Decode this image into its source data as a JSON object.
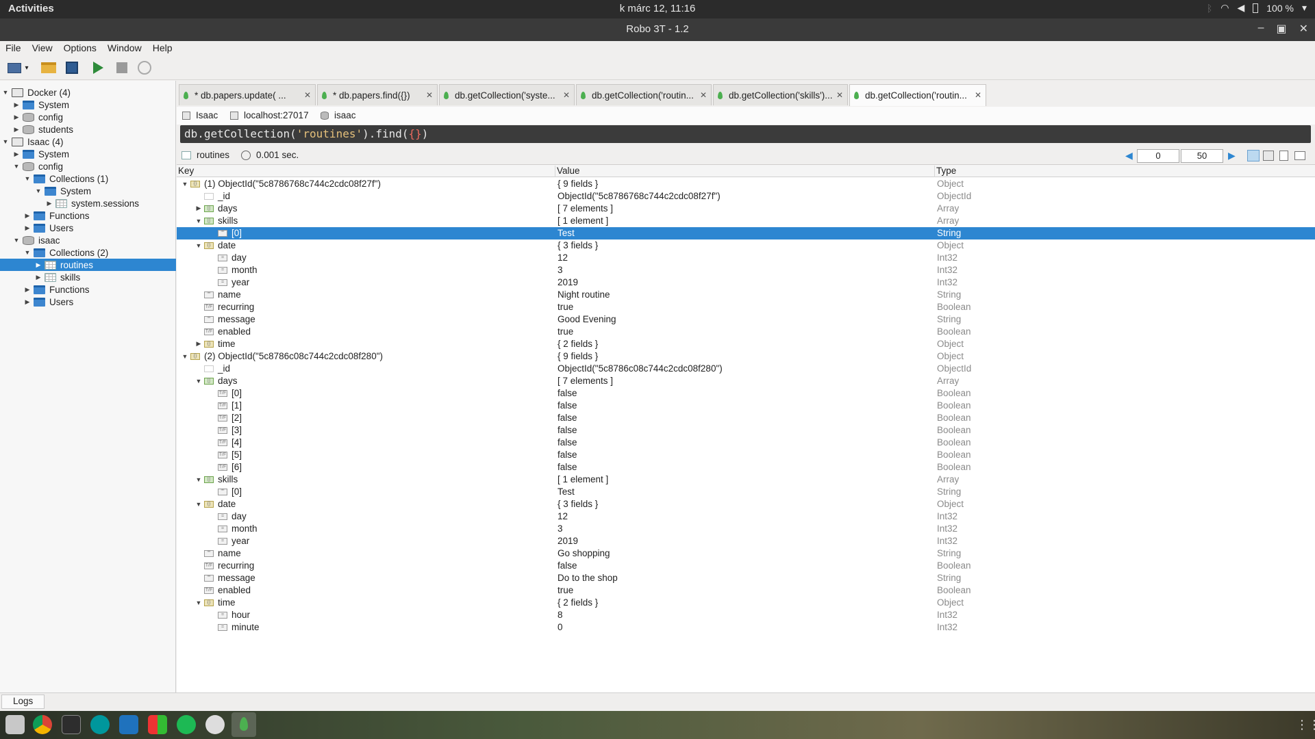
{
  "topbar": {
    "activities": "Activities",
    "clock": "k márc 12, 11:16",
    "battery": "100 %"
  },
  "window": {
    "title": "Robo 3T - 1.2"
  },
  "menu": [
    "File",
    "View",
    "Options",
    "Window",
    "Help"
  ],
  "tree": [
    {
      "label": "Docker (4)",
      "depth": 0,
      "icon": "server-icon",
      "arrow": "down"
    },
    {
      "label": "System",
      "depth": 1,
      "icon": "folder-icon",
      "arrow": "right"
    },
    {
      "label": "config",
      "depth": 1,
      "icon": "database-icon",
      "arrow": "right"
    },
    {
      "label": "students",
      "depth": 1,
      "icon": "database-icon",
      "arrow": "right"
    },
    {
      "label": "Isaac (4)",
      "depth": 0,
      "icon": "server-icon",
      "arrow": "down"
    },
    {
      "label": "System",
      "depth": 1,
      "icon": "folder-icon",
      "arrow": "right"
    },
    {
      "label": "config",
      "depth": 1,
      "icon": "database-icon",
      "arrow": "down"
    },
    {
      "label": "Collections (1)",
      "depth": 2,
      "icon": "folder-icon",
      "arrow": "down"
    },
    {
      "label": "System",
      "depth": 3,
      "icon": "folder-icon",
      "arrow": "down"
    },
    {
      "label": "system.sessions",
      "depth": 4,
      "icon": "collection-icon",
      "arrow": "right"
    },
    {
      "label": "Functions",
      "depth": 2,
      "icon": "folder-icon",
      "arrow": "right"
    },
    {
      "label": "Users",
      "depth": 2,
      "icon": "folder-icon",
      "arrow": "right"
    },
    {
      "label": "isaac",
      "depth": 1,
      "icon": "database-icon",
      "arrow": "down"
    },
    {
      "label": "Collections (2)",
      "depth": 2,
      "icon": "folder-icon",
      "arrow": "down"
    },
    {
      "label": "routines",
      "depth": 3,
      "icon": "collection-icon",
      "arrow": "right",
      "selected": true
    },
    {
      "label": "skills",
      "depth": 3,
      "icon": "collection-icon",
      "arrow": "right"
    },
    {
      "label": "Functions",
      "depth": 2,
      "icon": "folder-icon",
      "arrow": "right"
    },
    {
      "label": "Users",
      "depth": 2,
      "icon": "folder-icon",
      "arrow": "right"
    }
  ],
  "tabs": [
    {
      "label": "* db.papers.update(      ..."
    },
    {
      "label": "* db.papers.find({})"
    },
    {
      "label": "db.getCollection('syste..."
    },
    {
      "label": "db.getCollection('routin..."
    },
    {
      "label": "db.getCollection('skills')..."
    },
    {
      "label": "db.getCollection('routin...",
      "active": true
    }
  ],
  "connection": {
    "server": "Isaac",
    "host": "localhost:27017",
    "database": "isaac"
  },
  "query": {
    "prefix": "db.getCollection(",
    "string": "'routines'",
    "middle": ").find(",
    "arg": "{}",
    "suffix": ")"
  },
  "result": {
    "collection": "routines",
    "time": "0.001 sec.",
    "skip": "0",
    "limit": "50"
  },
  "columns": {
    "key": "Key",
    "value": "Value",
    "type": "Type"
  },
  "rows": [
    {
      "d": 0,
      "a": "down",
      "ic": "obj",
      "k": "(1) ObjectId(\"5c8786768c744c2cdc08f27f\")",
      "v": "{ 9 fields }",
      "t": "Object"
    },
    {
      "d": 1,
      "a": "",
      "ic": "id",
      "k": "_id",
      "v": "ObjectId(\"5c8786768c744c2cdc08f27f\")",
      "t": "ObjectId"
    },
    {
      "d": 1,
      "a": "right",
      "ic": "arr",
      "k": "days",
      "v": "[ 7 elements ]",
      "t": "Array"
    },
    {
      "d": 1,
      "a": "down",
      "ic": "arr",
      "k": "skills",
      "v": "[ 1 element ]",
      "t": "Array"
    },
    {
      "d": 2,
      "a": "",
      "ic": "str",
      "k": "[0]",
      "v": "Test",
      "t": "String",
      "sel": true
    },
    {
      "d": 1,
      "a": "down",
      "ic": "obj",
      "k": "date",
      "v": "{ 3 fields }",
      "t": "Object"
    },
    {
      "d": 2,
      "a": "",
      "ic": "int",
      "k": "day",
      "v": "12",
      "t": "Int32"
    },
    {
      "d": 2,
      "a": "",
      "ic": "int",
      "k": "month",
      "v": "3",
      "t": "Int32"
    },
    {
      "d": 2,
      "a": "",
      "ic": "int",
      "k": "year",
      "v": "2019",
      "t": "Int32"
    },
    {
      "d": 1,
      "a": "",
      "ic": "str",
      "k": "name",
      "v": "Night routine",
      "t": "String"
    },
    {
      "d": 1,
      "a": "",
      "ic": "bool",
      "k": "recurring",
      "v": "true",
      "t": "Boolean"
    },
    {
      "d": 1,
      "a": "",
      "ic": "str",
      "k": "message",
      "v": "Good Evening",
      "t": "String"
    },
    {
      "d": 1,
      "a": "",
      "ic": "bool",
      "k": "enabled",
      "v": "true",
      "t": "Boolean"
    },
    {
      "d": 1,
      "a": "right",
      "ic": "obj",
      "k": "time",
      "v": "{ 2 fields }",
      "t": "Object"
    },
    {
      "d": 0,
      "a": "down",
      "ic": "obj",
      "k": "(2) ObjectId(\"5c8786c08c744c2cdc08f280\")",
      "v": "{ 9 fields }",
      "t": "Object"
    },
    {
      "d": 1,
      "a": "",
      "ic": "id",
      "k": "_id",
      "v": "ObjectId(\"5c8786c08c744c2cdc08f280\")",
      "t": "ObjectId"
    },
    {
      "d": 1,
      "a": "down",
      "ic": "arr",
      "k": "days",
      "v": "[ 7 elements ]",
      "t": "Array"
    },
    {
      "d": 2,
      "a": "",
      "ic": "bool",
      "k": "[0]",
      "v": "false",
      "t": "Boolean"
    },
    {
      "d": 2,
      "a": "",
      "ic": "bool",
      "k": "[1]",
      "v": "false",
      "t": "Boolean"
    },
    {
      "d": 2,
      "a": "",
      "ic": "bool",
      "k": "[2]",
      "v": "false",
      "t": "Boolean"
    },
    {
      "d": 2,
      "a": "",
      "ic": "bool",
      "k": "[3]",
      "v": "false",
      "t": "Boolean"
    },
    {
      "d": 2,
      "a": "",
      "ic": "bool",
      "k": "[4]",
      "v": "false",
      "t": "Boolean"
    },
    {
      "d": 2,
      "a": "",
      "ic": "bool",
      "k": "[5]",
      "v": "false",
      "t": "Boolean"
    },
    {
      "d": 2,
      "a": "",
      "ic": "bool",
      "k": "[6]",
      "v": "false",
      "t": "Boolean"
    },
    {
      "d": 1,
      "a": "down",
      "ic": "arr",
      "k": "skills",
      "v": "[ 1 element ]",
      "t": "Array"
    },
    {
      "d": 2,
      "a": "",
      "ic": "str",
      "k": "[0]",
      "v": "Test",
      "t": "String"
    },
    {
      "d": 1,
      "a": "down",
      "ic": "obj",
      "k": "date",
      "v": "{ 3 fields }",
      "t": "Object"
    },
    {
      "d": 2,
      "a": "",
      "ic": "int",
      "k": "day",
      "v": "12",
      "t": "Int32"
    },
    {
      "d": 2,
      "a": "",
      "ic": "int",
      "k": "month",
      "v": "3",
      "t": "Int32"
    },
    {
      "d": 2,
      "a": "",
      "ic": "int",
      "k": "year",
      "v": "2019",
      "t": "Int32"
    },
    {
      "d": 1,
      "a": "",
      "ic": "str",
      "k": "name",
      "v": "Go shopping",
      "t": "String"
    },
    {
      "d": 1,
      "a": "",
      "ic": "bool",
      "k": "recurring",
      "v": "false",
      "t": "Boolean"
    },
    {
      "d": 1,
      "a": "",
      "ic": "str",
      "k": "message",
      "v": "Do to the shop",
      "t": "String"
    },
    {
      "d": 1,
      "a": "",
      "ic": "bool",
      "k": "enabled",
      "v": "true",
      "t": "Boolean"
    },
    {
      "d": 1,
      "a": "down",
      "ic": "obj",
      "k": "time",
      "v": "{ 2 fields }",
      "t": "Object"
    },
    {
      "d": 2,
      "a": "",
      "ic": "int",
      "k": "hour",
      "v": "8",
      "t": "Int32"
    },
    {
      "d": 2,
      "a": "",
      "ic": "int",
      "k": "minute",
      "v": "0",
      "t": "Int32"
    }
  ],
  "logs": {
    "label": "Logs"
  },
  "colors": {
    "selection": "#2d86d1",
    "folder": "#3d86cf",
    "mongo_leaf": "#4caf50"
  }
}
